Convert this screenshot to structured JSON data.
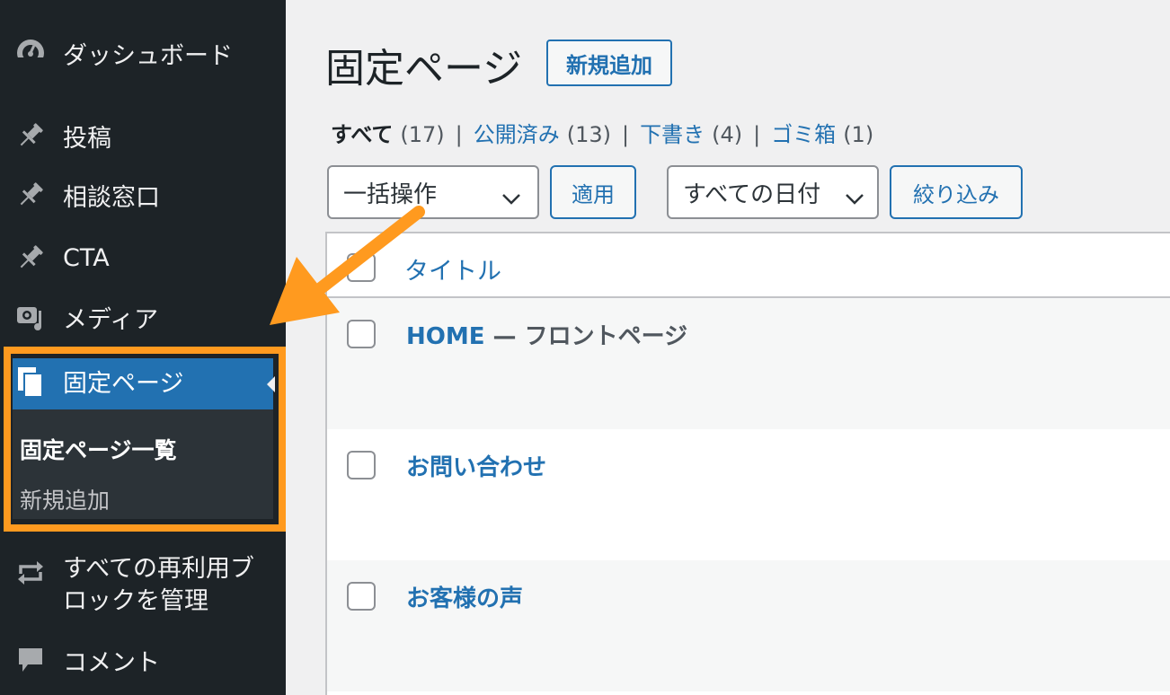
{
  "sidebar": {
    "items": [
      {
        "label": "ダッシュボード",
        "icon": "dashboard-icon"
      },
      {
        "label": "投稿",
        "icon": "pushpin-icon"
      },
      {
        "label": "相談窓口",
        "icon": "pushpin-icon"
      },
      {
        "label": "CTA",
        "icon": "pushpin-icon"
      },
      {
        "label": "メディア",
        "icon": "media-icon"
      },
      {
        "label": "固定ページ",
        "icon": "pages-icon"
      },
      {
        "label": "すべての再利用ブロックを管理",
        "icon": "reusable-blocks-icon"
      },
      {
        "label": "コメント",
        "icon": "comment-icon"
      }
    ],
    "submenu": {
      "current": "固定ページ一覧",
      "add_new": "新規追加"
    }
  },
  "header": {
    "title": "固定ページ",
    "add_new": "新規追加"
  },
  "filters": {
    "all": {
      "label": "すべて",
      "count": "(17)"
    },
    "published": {
      "label": "公開済み",
      "count": "(13)"
    },
    "draft": {
      "label": "下書き",
      "count": "(4)"
    },
    "trash": {
      "label": "ゴミ箱",
      "count": "(1)"
    },
    "separator": "|"
  },
  "toolbar": {
    "bulk_action": "一括操作",
    "apply": "適用",
    "date_filter": "すべての日付",
    "filter_button": "絞り込み"
  },
  "table": {
    "column_title": "タイトル",
    "rows": [
      {
        "title": "HOME",
        "state": " — フロントページ"
      },
      {
        "title": "お問い合わせ",
        "state": ""
      },
      {
        "title": "お客様の声",
        "state": ""
      }
    ]
  },
  "colors": {
    "sidebar_bg": "#1d2327",
    "accent": "#2271b1",
    "highlight": "#ff9a1f"
  }
}
